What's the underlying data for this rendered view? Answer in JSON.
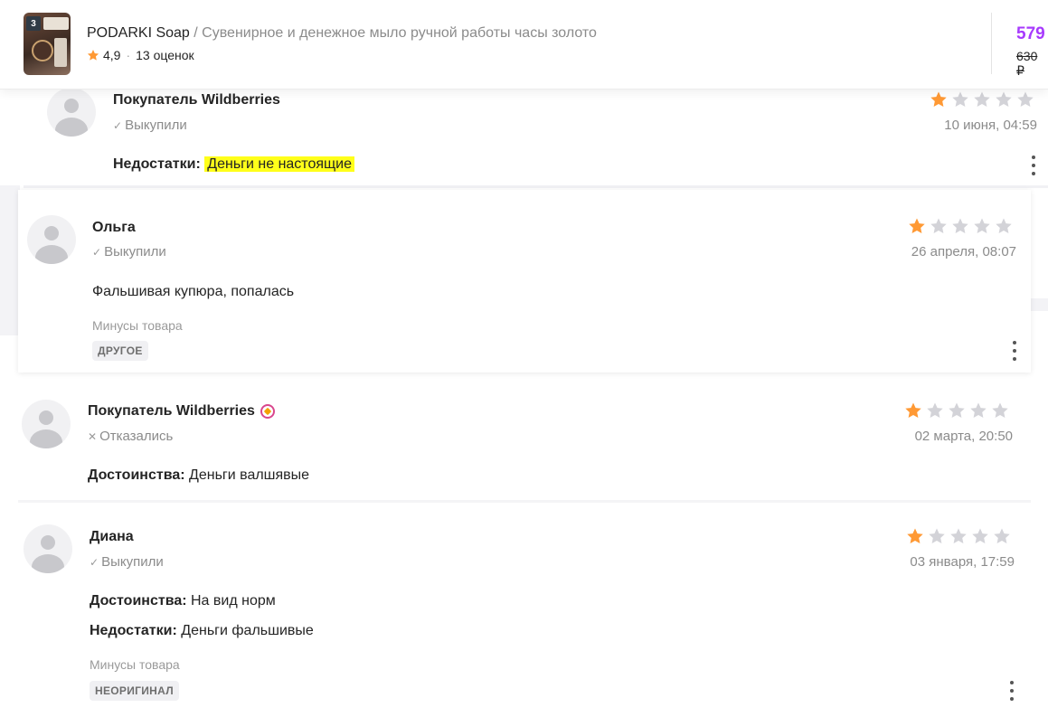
{
  "header": {
    "brand": "PODARKI Soap",
    "separator": " / ",
    "title": "Сувенирное и денежное мыло ручной работы часы золото",
    "rating": "4,9",
    "dot": "·",
    "ratings_count": "13 оценок",
    "price_now": "579",
    "price_old": "630 ₽",
    "thumb_badge": "3"
  },
  "colors": {
    "star_filled": "#ff9934",
    "star_empty": "#d3d3d8",
    "price_accent": "#a73afd",
    "highlight": "#ffff1a",
    "vip_badge": "#d9478d"
  },
  "reviews": [
    {
      "author": "Покупатель Wildberries",
      "status_icon": "check-icon",
      "status_mark": "✓",
      "status": "Выкупили",
      "date": "10 июня, 04:59",
      "rating": 1,
      "lines": [
        {
          "label": "Недостатки:",
          "text": "Деньги не настоящие",
          "highlighted": true
        }
      ]
    },
    {
      "author": "Ольга",
      "status_icon": "check-icon",
      "status_mark": "✓",
      "status": "Выкупили",
      "date": "26 апреля, 08:07",
      "rating": 1,
      "text": "Фальшивая купюра, попалась",
      "minus_label": "Минусы товара",
      "tag": "ДРУГОЕ"
    },
    {
      "author": "Покупатель Wildberries",
      "badge_icon": "vip-badge-icon",
      "status_icon": "cross-icon",
      "status_mark": "✕",
      "status": "Отказались",
      "date": "02 марта, 20:50",
      "rating": 1,
      "lines": [
        {
          "label": "Достоинства:",
          "text": "Деньги валшявые"
        }
      ]
    },
    {
      "author": "Диана",
      "status_icon": "check-icon",
      "status_mark": "✓",
      "status": "Выкупили",
      "date": "03 января, 17:59",
      "rating": 1,
      "lines": [
        {
          "label": "Достоинства:",
          "text": "На вид норм"
        },
        {
          "label": "Недостатки:",
          "text": "Деньги фальшивые"
        }
      ],
      "minus_label": "Минусы товара",
      "tag": "НЕОРИГИНАЛ"
    }
  ]
}
